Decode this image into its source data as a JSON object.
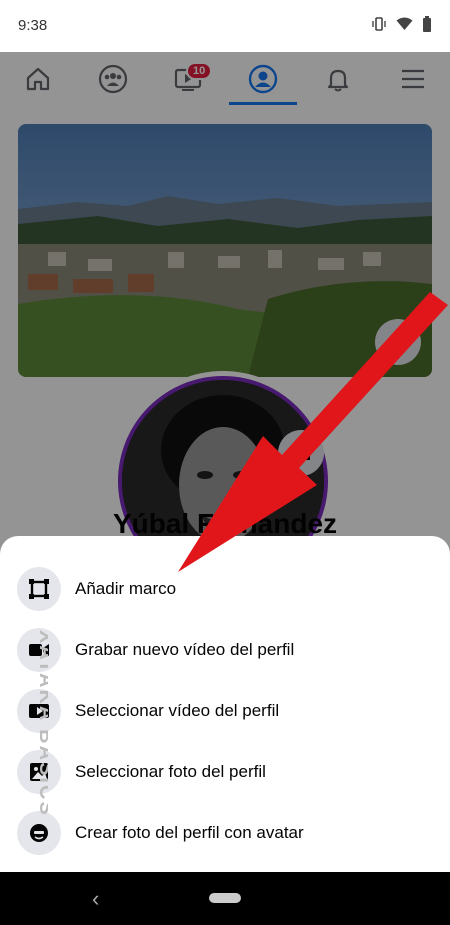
{
  "status": {
    "time": "9:38"
  },
  "tabs": {
    "home": "home-icon",
    "groups": "groups-icon",
    "watch": "watch-icon",
    "watch_badge": "10",
    "profile": "profile-icon",
    "notifications": "bell-icon",
    "menu": "menu-icon"
  },
  "profile": {
    "name": "Yúbal Fernández"
  },
  "sheet": {
    "options": [
      {
        "label": "Añadir marco",
        "icon": "frame-icon"
      },
      {
        "label": "Grabar nuevo vídeo del perfil",
        "icon": "video-camera-icon"
      },
      {
        "label": "Seleccionar vídeo del perfil",
        "icon": "video-play-icon"
      },
      {
        "label": "Seleccionar foto del perfil",
        "icon": "photo-icon"
      },
      {
        "label": "Crear foto del perfil con avatar",
        "icon": "avatar-icon"
      }
    ]
  },
  "watermark": "XATAKA BASICS",
  "colors": {
    "accent": "#1877f2",
    "badge": "#e41e3f",
    "arrow": "#e0161a",
    "avatar_ring": "#7b2cbf"
  }
}
